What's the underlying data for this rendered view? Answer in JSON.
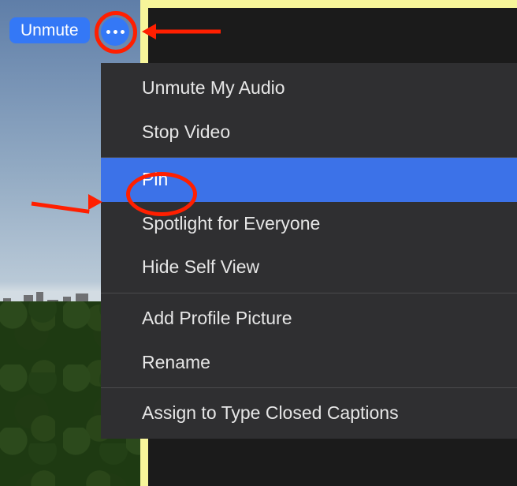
{
  "toolbar": {
    "unmute_label": "Unmute",
    "more_button_name": "more-options"
  },
  "menu": {
    "groups": [
      {
        "items": [
          {
            "label": "Unmute My Audio",
            "highlighted": false
          },
          {
            "label": "Stop Video",
            "highlighted": false
          }
        ]
      },
      {
        "items": [
          {
            "label": "Pin",
            "highlighted": true
          },
          {
            "label": "Spotlight for Everyone",
            "highlighted": false
          },
          {
            "label": "Hide Self View",
            "highlighted": false
          }
        ]
      },
      {
        "items": [
          {
            "label": "Add Profile Picture",
            "highlighted": false
          },
          {
            "label": "Rename",
            "highlighted": false
          }
        ]
      },
      {
        "items": [
          {
            "label": "Assign to Type Closed Captions",
            "highlighted": false
          }
        ]
      }
    ]
  },
  "annotations": {
    "circle_more": true,
    "circle_pin": true,
    "arrow_to_more": true,
    "arrow_to_pin": true,
    "color": "#ff1f00"
  }
}
